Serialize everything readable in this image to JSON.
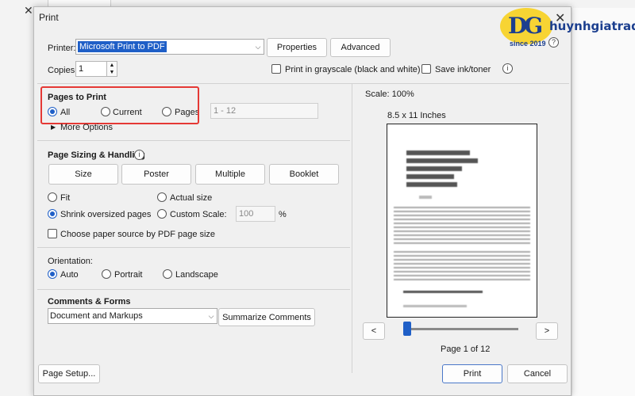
{
  "window": {
    "title": "Print"
  },
  "printer": {
    "label": "Printer:",
    "selected": "Microsoft Print to PDF",
    "properties_label": "Properties",
    "advanced_label": "Advanced",
    "help_label": "Help"
  },
  "copies": {
    "label": "Copies:",
    "value": "1"
  },
  "options": {
    "grayscale_label": "Print in grayscale (black and white)",
    "save_ink_label": "Save ink/toner"
  },
  "pages_to_print": {
    "title": "Pages to Print",
    "all_label": "All",
    "current_label": "Current",
    "pages_label": "Pages",
    "range_placeholder": "1 - 12",
    "more_options_label": "More Options",
    "selected": "All"
  },
  "page_sizing": {
    "title": "Page Sizing & Handling",
    "tabs": [
      "Size",
      "Poster",
      "Multiple",
      "Booklet"
    ],
    "fit_label": "Fit",
    "actual_size_label": "Actual size",
    "shrink_label": "Shrink oversized pages",
    "custom_scale_label": "Custom Scale:",
    "custom_scale_value": "100",
    "percent": "%",
    "choose_paper_label": "Choose paper source by PDF page size",
    "selected": "Shrink oversized pages"
  },
  "orientation": {
    "title": "Orientation:",
    "auto_label": "Auto",
    "portrait_label": "Portrait",
    "landscape_label": "Landscape",
    "selected": "Auto"
  },
  "comments": {
    "title": "Comments & Forms",
    "selected": "Document and Markups",
    "summarize_label": "Summarize Comments"
  },
  "preview": {
    "scale_label": "Scale: 100%",
    "paper_size": "8.5 x 11 Inches",
    "prev_label": "<",
    "next_label": ">",
    "page_indicator": "Page 1 of 12",
    "slider_position": 0.0
  },
  "footer": {
    "page_setup_label": "Page Setup...",
    "print_label": "Print",
    "cancel_label": "Cancel"
  },
  "watermark": {
    "brand": "huynhgiatrading",
    "since": "since 2019"
  },
  "colors": {
    "accent": "#1f5fc7",
    "highlight_box": "#e53935"
  }
}
